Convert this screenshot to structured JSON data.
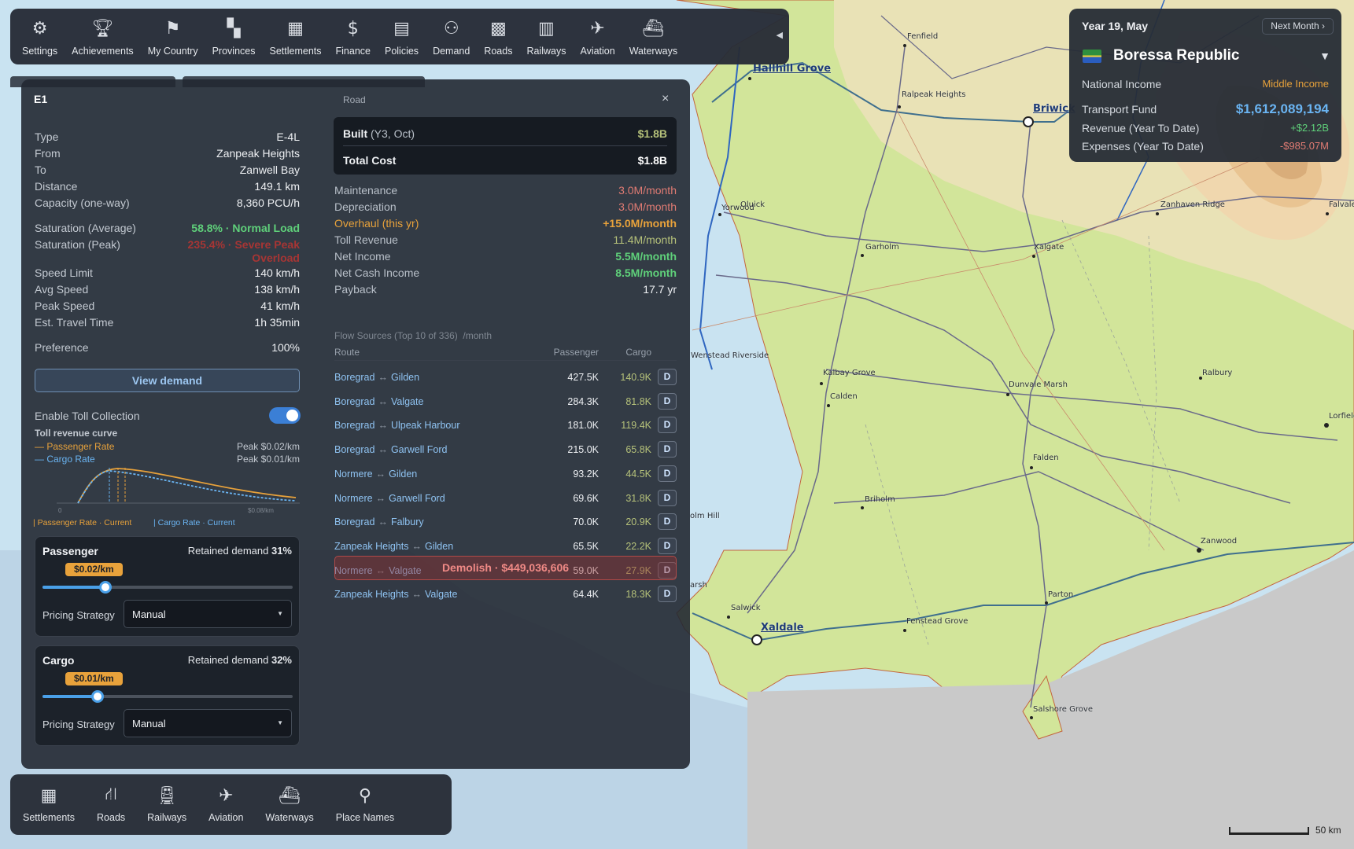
{
  "toolbar": {
    "items": [
      {
        "label": "Settings",
        "icon": "gear-icon"
      },
      {
        "label": "Achievements",
        "icon": "trophy-icon"
      },
      {
        "label": "My Country",
        "icon": "flag-icon"
      },
      {
        "label": "Provinces",
        "icon": "map-icon"
      },
      {
        "label": "Settlements",
        "icon": "buildings-icon"
      },
      {
        "label": "Finance",
        "icon": "dollar-icon"
      },
      {
        "label": "Policies",
        "icon": "document-icon"
      },
      {
        "label": "Demand",
        "icon": "people-icon"
      },
      {
        "label": "Roads",
        "icon": "road-grid-icon"
      },
      {
        "label": "Railways",
        "icon": "rail-icon"
      },
      {
        "label": "Aviation",
        "icon": "plane-icon"
      },
      {
        "label": "Waterways",
        "icon": "ship-icon"
      }
    ],
    "collapse": "◀"
  },
  "panel": {
    "title": "E1",
    "type": "Road",
    "close": "×",
    "details": [
      {
        "k": "Type",
        "v": "E-4L"
      },
      {
        "k": "From",
        "v": "Zanpeak Heights"
      },
      {
        "k": "To",
        "v": "Zanwell Bay"
      },
      {
        "k": "Distance",
        "v": "149.1 km"
      },
      {
        "k": "Capacity (one-way)",
        "v": "8,360 PCU/h"
      }
    ],
    "saturation_avg": {
      "k": "Saturation (Average)",
      "v": "58.8% · Normal Load"
    },
    "saturation_peak": {
      "k": "Saturation (Peak)",
      "v": "235.4% · Severe Peak Overload"
    },
    "speeds": [
      {
        "k": "Speed Limit",
        "v": "140 km/h"
      },
      {
        "k": "Avg Speed",
        "v": "138 km/h"
      },
      {
        "k": "Peak Speed",
        "v": "41 km/h"
      },
      {
        "k": "Est. Travel Time",
        "v": "1h 35min"
      }
    ],
    "preference": {
      "k": "Preference",
      "v": "100%"
    },
    "view_demand": "View demand",
    "toll": {
      "enable_label": "Enable Toll Collection",
      "enabled": true,
      "curve_title": "Toll revenue curve",
      "passenger_legend": "— Passenger Rate",
      "cargo_legend": "— Cargo Rate",
      "passenger_peak": "Peak $0.02/km",
      "cargo_peak": "Peak $0.01/km",
      "axis_min": "0",
      "axis_max": "$0.08/km",
      "marker_passenger": "| Passenger Rate · Current",
      "marker_cargo": "| Cargo Rate · Current"
    },
    "passenger": {
      "name": "Passenger",
      "retained_label": "Retained demand",
      "retained_value": "31%",
      "rate": "$0.02/km",
      "slider_fraction": 0.25,
      "strategy_label": "Pricing Strategy",
      "strategy": "Manual"
    },
    "cargo": {
      "name": "Cargo",
      "retained_label": "Retained demand",
      "retained_value": "32%",
      "rate": "$0.01/km",
      "slider_fraction": 0.22,
      "strategy_label": "Pricing Strategy",
      "strategy": "Manual"
    },
    "cost": {
      "built_label": "Built",
      "built_date": "(Y3, Oct)",
      "built_value": "$1.8B",
      "total_label": "Total Cost",
      "total_value": "$1.8B"
    },
    "finance": [
      {
        "k": "Maintenance",
        "v": "3.0M/month",
        "color": "#e07b73"
      },
      {
        "k": "Depreciation",
        "v": "3.0M/month",
        "color": "#e07b73"
      },
      {
        "k": "Overhaul (this yr)",
        "v": "+15.0M/month",
        "color": "#e8a23b"
      },
      {
        "k": "Toll Revenue",
        "v": "11.4M/month",
        "color": "#b6c27a"
      },
      {
        "k": "Net Income",
        "v": "5.5M/month",
        "color": "#5fd07a"
      },
      {
        "k": "Net Cash Income",
        "v": "8.5M/month",
        "color": "#5fd07a"
      },
      {
        "k": "Payback",
        "v": "17.7 yr",
        "color": "#eef0f3"
      }
    ],
    "flow": {
      "title": "Flow Sources (Top 10 of 336)",
      "unit": "/month",
      "col_route": "Route",
      "col_passenger": "Passenger",
      "col_cargo": "Cargo",
      "arrow": "↔",
      "detail_button": "D",
      "rows": [
        {
          "from": "Boregrad",
          "to": "Gilden",
          "passenger": "427.5K",
          "cargo": "140.9K"
        },
        {
          "from": "Boregrad",
          "to": "Valgate",
          "passenger": "284.3K",
          "cargo": "81.8K"
        },
        {
          "from": "Boregrad",
          "to": "Ulpeak Harbour",
          "passenger": "181.0K",
          "cargo": "119.4K"
        },
        {
          "from": "Boregrad",
          "to": "Garwell Ford",
          "passenger": "215.0K",
          "cargo": "65.8K"
        },
        {
          "from": "Normere",
          "to": "Gilden",
          "passenger": "93.2K",
          "cargo": "44.5K"
        },
        {
          "from": "Normere",
          "to": "Garwell Ford",
          "passenger": "69.6K",
          "cargo": "31.8K"
        },
        {
          "from": "Boregrad",
          "to": "Falbury",
          "passenger": "70.0K",
          "cargo": "20.9K"
        },
        {
          "from": "Zanpeak Heights",
          "to": "Gilden",
          "passenger": "65.5K",
          "cargo": "22.2K"
        },
        {
          "from": "Normere",
          "to": "Valgate",
          "passenger": "59.0K",
          "cargo": "27.9K"
        },
        {
          "from": "Zanpeak Heights",
          "to": "Valgate",
          "passenger": "64.4K",
          "cargo": "18.3K"
        }
      ]
    },
    "demolish": "Demolish · $449,036,606"
  },
  "bottombar": {
    "items": [
      {
        "label": "Settlements",
        "icon": "buildings-icon"
      },
      {
        "label": "Roads",
        "icon": "road-icon"
      },
      {
        "label": "Railways",
        "icon": "train-icon"
      },
      {
        "label": "Aviation",
        "icon": "plane-icon"
      },
      {
        "label": "Waterways",
        "icon": "ship-icon"
      },
      {
        "label": "Place Names",
        "icon": "map-pin-icon"
      }
    ]
  },
  "country": {
    "date": "Year 19, May",
    "next_month": "Next Month ›",
    "name": "Boressa Republic",
    "dropdown": "▼",
    "rows": [
      {
        "k": "National Income",
        "v": "Middle Income",
        "color": "#e8a23b"
      },
      {
        "k": "Transport Fund",
        "v": "$1,612,089,194",
        "color": "#6ab4f2"
      },
      {
        "k": "Revenue (Year To Date)",
        "v": "+$2.12B",
        "color": "#5fd07a"
      },
      {
        "k": "Expenses (Year To Date)",
        "v": "-$985.07M",
        "color": "#e07b73"
      }
    ]
  },
  "map": {
    "places": [
      "Fenfield",
      "Hallhill Grove",
      "Ralpeak Heights",
      "Briwick",
      "Zanhaven Ridge",
      "Falvale",
      "Yorwood",
      "Oluick",
      "Garholm",
      "Xalgate",
      "Wenstead Riverside",
      "Kalbay Grove",
      "Calden",
      "Dunvale Marsh",
      "Ralbury",
      "Lorfield",
      "Falden",
      "Briholm",
      "Zanwood",
      "Parton",
      "Salwick",
      "Xaldale",
      "Fenstead Grove",
      "Salshore Grove",
      "olm Hill",
      "arsh"
    ],
    "scale": "50 km"
  }
}
